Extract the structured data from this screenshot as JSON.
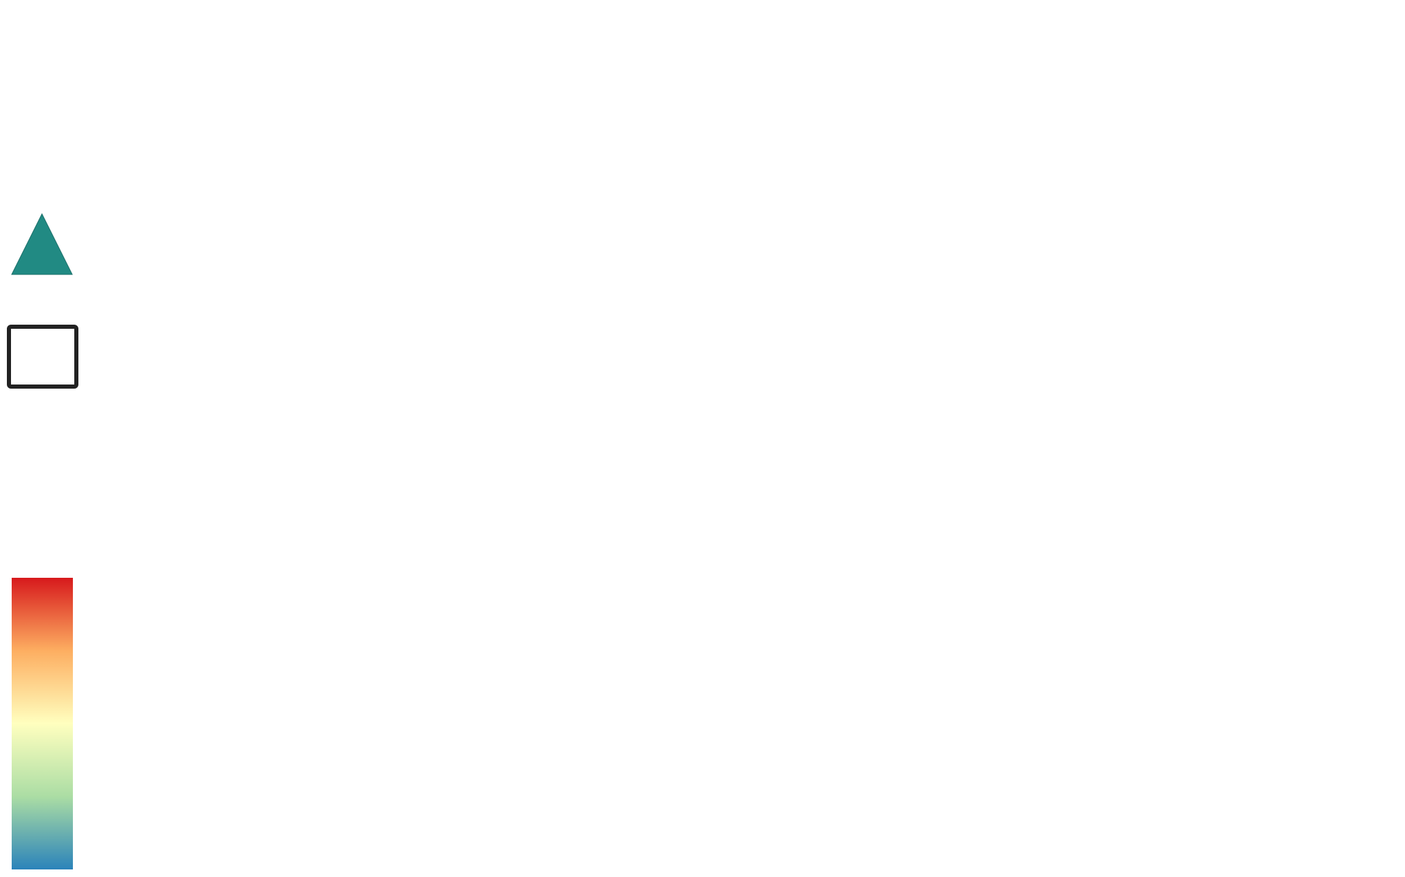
{
  "legend": {
    "marker_triangle": {
      "icon": "triangle-icon",
      "fill_color": "#218a83"
    },
    "marker_rectangle": {
      "icon": "rectangle-outline-icon",
      "stroke_color": "#222222"
    },
    "colorbar": {
      "icon": "colorbar-gradient",
      "colors": [
        "#d7191c",
        "#fdae61",
        "#ffffbf",
        "#abdda4",
        "#2b83ba"
      ]
    }
  }
}
